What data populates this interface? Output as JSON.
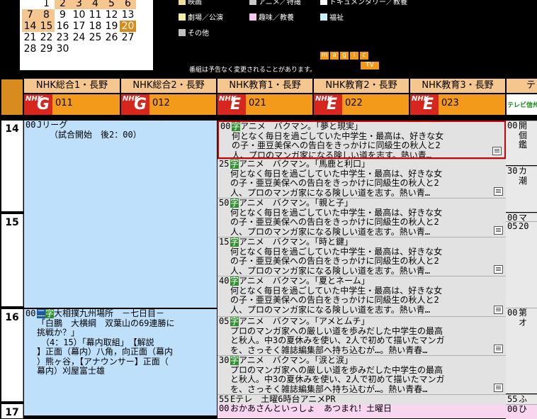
{
  "calendar": {
    "rows": [
      [
        "1",
        "2",
        "3",
        "4",
        "5",
        "6"
      ],
      [
        "7",
        "8",
        "9",
        "10",
        "11",
        "12",
        "13"
      ],
      [
        "14",
        "15",
        "16",
        "17",
        "18",
        "19",
        "20"
      ],
      [
        "21",
        "22",
        "23",
        "24",
        "25",
        "26",
        "27"
      ],
      [
        "28",
        "29",
        "30"
      ]
    ],
    "today": "20"
  },
  "legend": [
    {
      "label": "映画",
      "color": "#f2dc9a"
    },
    {
      "label": "アニメ／特撮",
      "color": "#c8c8c8"
    },
    {
      "label": "ドキュメンタリー／教養",
      "color": "#ffffff"
    },
    {
      "label": "劇場／公演",
      "color": "#f0f0a0"
    },
    {
      "label": "趣味／教養",
      "color": "#f6c8f0"
    },
    {
      "label": "福祉",
      "color": "#c8f0ff"
    },
    {
      "label": "その他",
      "color": "#c0c0c0"
    }
  ],
  "note": "番組は予告なく変更されることがあります。",
  "magic_letters": [
    "m",
    "a",
    "g",
    "i",
    "c"
  ],
  "tv_label": "TV",
  "channels": [
    {
      "name": "NHK総合1・長野",
      "letter": "G",
      "num": "011"
    },
    {
      "name": "NHK総合2・長野",
      "letter": "G",
      "num": "012"
    },
    {
      "name": "NHK教育1・長野",
      "letter": "E",
      "num": "021"
    },
    {
      "name": "NHK教育2・長野",
      "letter": "E",
      "num": "022"
    },
    {
      "name": "NHK教育3・長野",
      "letter": "E",
      "num": "023"
    },
    {
      "name": "テレ",
      "letter": "",
      "num": ""
    }
  ],
  "nhk_label": "NHK",
  "right_logo": "テレビ信州",
  "hours": [
    "14",
    "15",
    "16",
    "17"
  ],
  "col1": {
    "p1": {
      "min": "00",
      "lines": [
        "Jリーグ",
        "　　（試合開始　後2：00）"
      ]
    },
    "p2": {
      "min": "00",
      "badge1": "二",
      "badge2": "字",
      "lines": [
        "大相撲九州場所　－七日目－",
        "「白鵬　大横綱　双葉山の69連勝に",
        "挑戦か？」",
        "　（4：15）「幕内取組」　【解説",
        "】正面（幕内）八角，向正面（幕内",
        "）熊ヶ谷，【アナウンサー】正面（",
        "幕内）刈屋富士雄"
      ]
    }
  },
  "col3": [
    {
      "min": "00",
      "badge": "字",
      "title": "アニメ　バクマン。「夢と現実」",
      "lines": [
        "何となく毎日を過ごしていた中学生・最高は、好きな女",
        "の子・亜豆美保への告白をきっかけに同級生の秋人と2",
        "人、プロのマンガ家になる険しい道を志す。熱い青…"
      ]
    },
    {
      "min": "25",
      "badge": "字",
      "title": "アニメ　バクマン。「馬鹿と利口」",
      "lines": [
        "何となく毎日を過ごしていた中学生・最高は、好きな女",
        "の子・亜豆美保への告白をきっかけに同級生の秋人と2",
        "人、プロのマンガ家になる険しい道を志す。熱い青…"
      ]
    },
    {
      "min": "50",
      "badge": "字",
      "title": "アニメ　バクマン。「親と子」",
      "lines": [
        "何となく毎日を過ごしていた中学生・最高は、好きな女",
        "の子・亜豆美保への告白をきっかけに同級生の秋人と2",
        "人、プロのマンガ家になる険しい道を志す。熱い青…"
      ]
    },
    {
      "min": "15",
      "badge": "字",
      "title": "アニメ　バクマン。「時と鍵」",
      "lines": [
        "何となく毎日を過ごしていた中学生・最高は、好きな女",
        "の子・亜豆美保への告白をきっかけに同級生の秋人と2",
        "人、プロのマンガ家になる険しい道を志す。熱い青…"
      ]
    },
    {
      "min": "40",
      "badge": "字",
      "title": "アニメ　バクマン。「夏とネーム」",
      "lines": [
        "何となく毎日を過ごしていた中学生・最高は、好きな女",
        "の子・亜豆美保への告白をきっかけに同級生の秋人と2",
        "人、プロのマンガ家になる険しい道を志す。熱い青…"
      ]
    },
    {
      "min": "05",
      "badge": "字",
      "title": "アニメ　バクマン。「アメとムチ」",
      "lines": [
        "プロのマンガ家への厳しい道を歩みだした中学生の最高",
        "と秋人。中3の夏休みを使い、2人で初めて描いたマンガ",
        "を、さっそく雑誌編集部へ持ち込むが…。熱い青春…"
      ]
    },
    {
      "min": "30",
      "badge": "字",
      "title": "アニメ　バクマン。「涙と涙」",
      "lines": [
        "プロのマンガ家への厳しい道を歩みだした中学生の最高",
        "と秋人。中3の夏休みを使い、2人で初めて描いたマンガ",
        "を、さっそく雑誌編集部へ持ち込むが…。熱い青春…"
      ]
    },
    {
      "min": "55",
      "badge": "",
      "title": "Eテレ　土曜6時台アニメPR",
      "lines": []
    },
    {
      "min": "00",
      "badge": "",
      "title": "おかあさんといっしょ　あつまれ！土曜日",
      "lines": []
    }
  ],
  "rcol": [
    {
      "min": "00",
      "lines": [
        "開",
        "個",
        "鑑"
      ]
    },
    {
      "min": "30",
      "lines": [
        "カ",
        "潮"
      ]
    },
    {
      "min": "00",
      "lines": [
        "マ"
      ]
    },
    {
      "min": "05",
      "lines": [
        "20"
      ]
    },
    {
      "min": "00",
      "lines": [
        "第",
        "オ"
      ]
    },
    {
      "min": "55",
      "lines": [
        "ふ"
      ]
    },
    {
      "min": "00",
      "lines": [
        "ひ"
      ]
    }
  ]
}
